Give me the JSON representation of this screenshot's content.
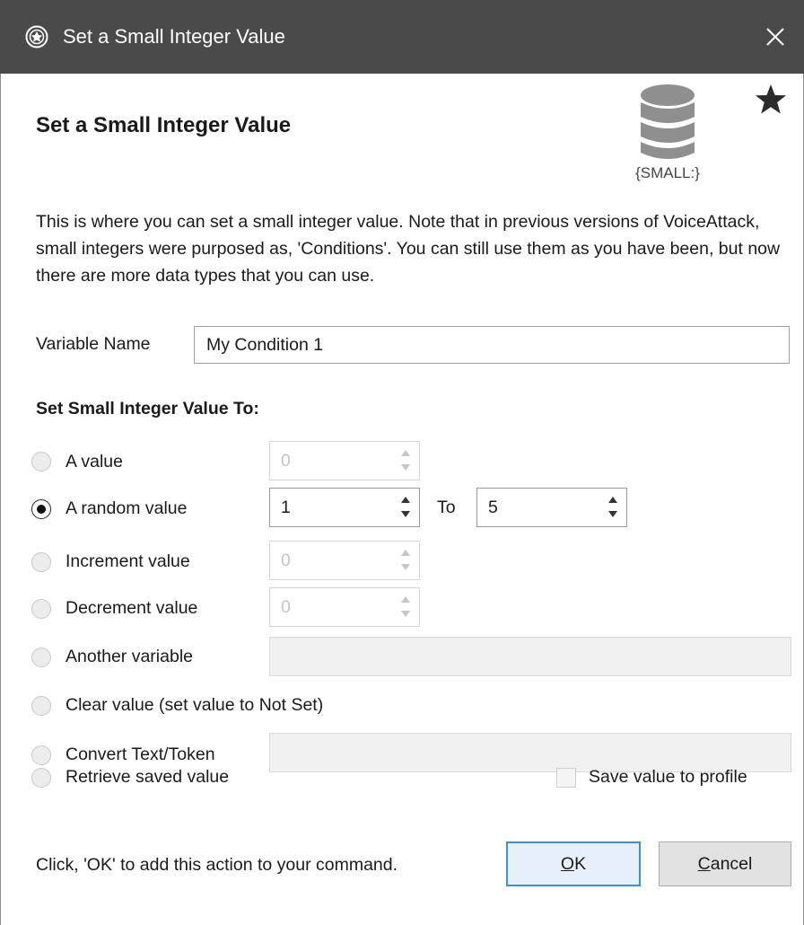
{
  "window": {
    "title": "Set a Small Integer Value",
    "close_glyph": "✕"
  },
  "header": {
    "heading": "Set a Small Integer Value",
    "icon_caption": "{SMALL:}",
    "icon_name": "database-icon",
    "favorite_icon": "star-icon"
  },
  "description": "This is where you can set a small integer value.  Note that in previous versions of VoiceAttack, small integers were purposed as, 'Conditions'.  You can still use them as you have been, but now there are more data types that you can use.",
  "variable": {
    "label": "Variable Name",
    "value": "My Condition 1"
  },
  "section_label": "Set Small Integer Value To:",
  "options": [
    {
      "label": "A value",
      "checked": false,
      "value": "0"
    },
    {
      "label": "A random value",
      "checked": true,
      "from": "1",
      "to_label": "To",
      "to": "5"
    },
    {
      "label": "Increment value",
      "checked": false,
      "value": "0"
    },
    {
      "label": "Decrement value",
      "checked": false,
      "value": "0"
    },
    {
      "label": "Another variable",
      "checked": false,
      "value": ""
    },
    {
      "label": "Clear value (set value to Not Set)",
      "checked": false
    },
    {
      "label": "Convert Text/Token",
      "checked": false,
      "value": ""
    },
    {
      "label": "Retrieve saved value",
      "checked": false
    }
  ],
  "save_to_profile": {
    "label": "Save value to profile",
    "checked": false
  },
  "footer": {
    "hint": "Click, 'OK' to add this action to your command.",
    "ok_accel": "O",
    "ok_rest": "K",
    "cancel_accel": "C",
    "cancel_rest": "ancel"
  },
  "colors": {
    "titlebar": "#4a4a4a",
    "ok_border": "#3c8fd6",
    "icon_gray": "#8f8f8f"
  }
}
